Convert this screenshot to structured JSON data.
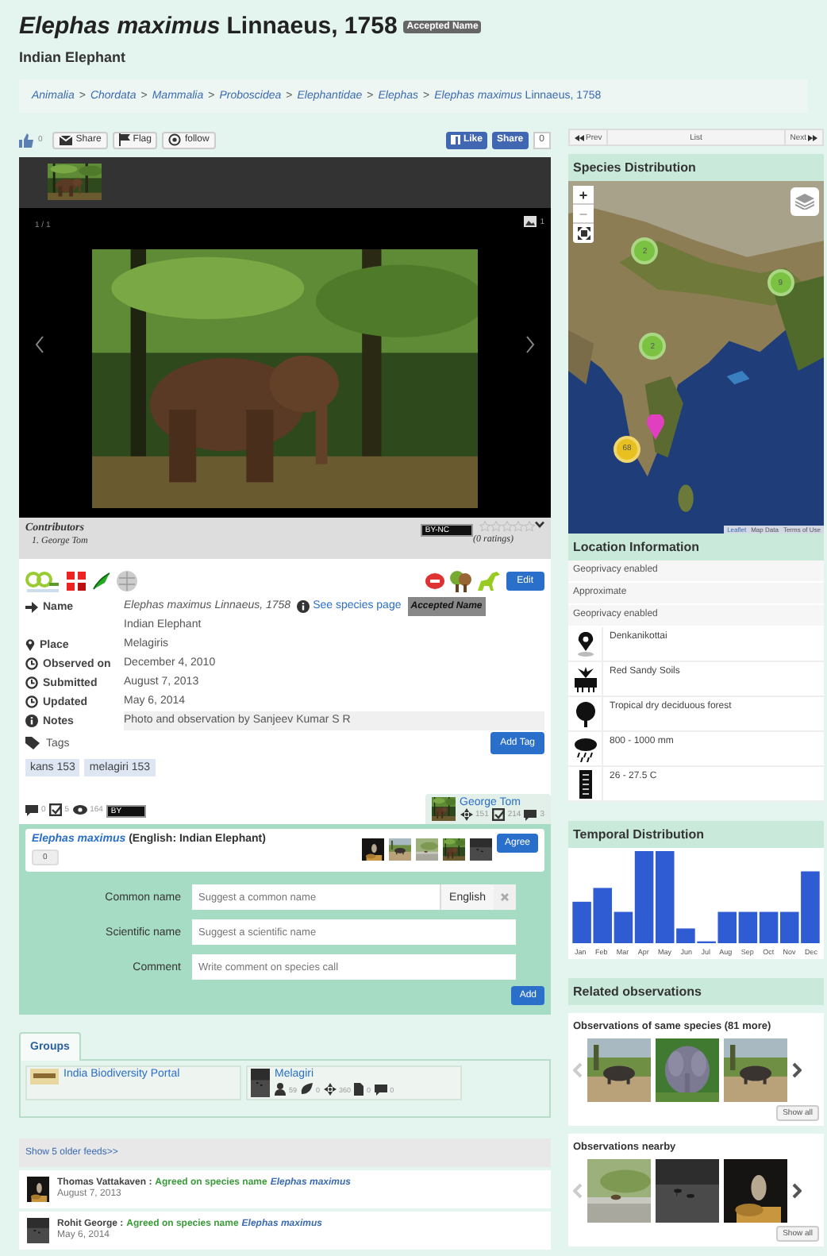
{
  "header": {
    "scientific_name": "Elephas maximus",
    "authority": "Linnaeus, 1758",
    "badge": "Accepted Name",
    "common_name": "Indian Elephant"
  },
  "breadcrumb": {
    "separator": ">",
    "items": [
      "Animalia",
      "Chordata",
      "Mammalia",
      "Proboscidea",
      "Elephantidae",
      "Elephas"
    ],
    "current": "*Elephas maximus* Linnaeus, 1758"
  },
  "actions": {
    "likes": "0",
    "buttons": [
      "Share",
      "Flag",
      "follow"
    ],
    "fb_like": "Like",
    "fb_share": "Share",
    "fb_count": "0"
  },
  "viewer": {
    "counter": "1 / 1",
    "image_count": "1"
  },
  "contributors": {
    "title": "Contributors",
    "names": [
      "1. George Tom"
    ],
    "license": "BY-NC",
    "stars": 0,
    "ratings": "(0 ratings)"
  },
  "info": {
    "edit": "Edit",
    "fields": [
      {
        "kind": "name",
        "label": "Name",
        "value": "Elephas maximus  Linnaeus, 1758",
        "link": "See species page",
        "badge": "Accepted Name",
        "sub": "Indian Elephant"
      },
      {
        "kind": "place",
        "label": "Place",
        "value": "Melagiris"
      },
      {
        "kind": "time",
        "label": "Observed on",
        "value": "December 4, 2010"
      },
      {
        "kind": "time",
        "label": "Submitted",
        "value": "August 7, 2013"
      },
      {
        "kind": "time",
        "label": "Updated",
        "value": "May 6, 2014"
      },
      {
        "kind": "notes",
        "label": "Notes",
        "value": "Photo and observation by Sanjeev Kumar S R"
      }
    ],
    "tags_label": "Tags",
    "add_tag": "Add Tag",
    "tags": [
      "kans 153",
      "melagiri 153"
    ]
  },
  "stats": {
    "comments": "0",
    "checks": "5",
    "views": "164",
    "license": "BY"
  },
  "owner": {
    "name": "George Tom",
    "stats": [
      "151",
      "214",
      "3"
    ]
  },
  "species_call": {
    "name": "Elephas maximus",
    "common": "(English: Indian Elephant)",
    "votes": "0",
    "agree": "Agree",
    "form": [
      {
        "label": "Common name",
        "placeholder": "Suggest a common name",
        "language": "English"
      },
      {
        "label": "Scientific name",
        "placeholder": "Suggest a scientific name"
      },
      {
        "label": "Comment",
        "placeholder": "Write comment on species call"
      }
    ],
    "add": "Add"
  },
  "groups": {
    "tab": "Groups",
    "items": [
      {
        "name": "India Biodiversity Portal"
      },
      {
        "name": "Melagiri",
        "stats": [
          "59",
          "0",
          "360",
          "0",
          "0"
        ]
      }
    ]
  },
  "feeds": {
    "older": "Show 5 older feeds>>",
    "items": [
      {
        "user": "Thomas Vattakaven :",
        "action": "Agreed on species name",
        "species": "Elephas maximus",
        "date": "August 7, 2013"
      },
      {
        "user": "Rohit George :",
        "action": "Agreed on species name",
        "species": "Elephas maximus",
        "date": "May 6, 2014"
      }
    ]
  },
  "nav": {
    "prev": "Prev",
    "list": "List",
    "next": "Next"
  },
  "distribution": {
    "title": "Species Distribution",
    "zoom_in": "+",
    "zoom_out": "−",
    "clusters": [
      {
        "count": "2",
        "color": "#7cc242"
      },
      {
        "count": "9",
        "color": "#7cc242"
      },
      {
        "count": "2",
        "color": "#7cc242"
      },
      {
        "count": "68",
        "color": "#e8c020"
      }
    ],
    "attribution": [
      "Leaflet",
      "Map Data",
      "Terms of Use"
    ]
  },
  "location": {
    "title": "Location Information",
    "rows": [
      "Geoprivacy enabled",
      "Approximate",
      "Geoprivacy enabled"
    ],
    "features": [
      {
        "kind": "pin",
        "text": "Denkanikottai"
      },
      {
        "kind": "soil",
        "text": "Red Sandy Soils"
      },
      {
        "kind": "tree",
        "text": "Tropical dry deciduous forest"
      },
      {
        "kind": "rain",
        "text": "800 - 1000 mm"
      },
      {
        "kind": "temperature",
        "text": "26 - 27.5 C"
      }
    ]
  },
  "temporal": {
    "title": "Temporal Distribution",
    "months": [
      "Jan",
      "Feb",
      "Mar",
      "Apr",
      "May",
      "Jun",
      "Jul",
      "Aug",
      "Sep",
      "Oct",
      "Nov",
      "Dec"
    ]
  },
  "related": {
    "title": "Related observations",
    "sections": [
      {
        "title": "Observations of same species (81 more)",
        "show_all": "Show all"
      },
      {
        "title": "Observations nearby",
        "show_all": "Show all"
      }
    ]
  }
}
